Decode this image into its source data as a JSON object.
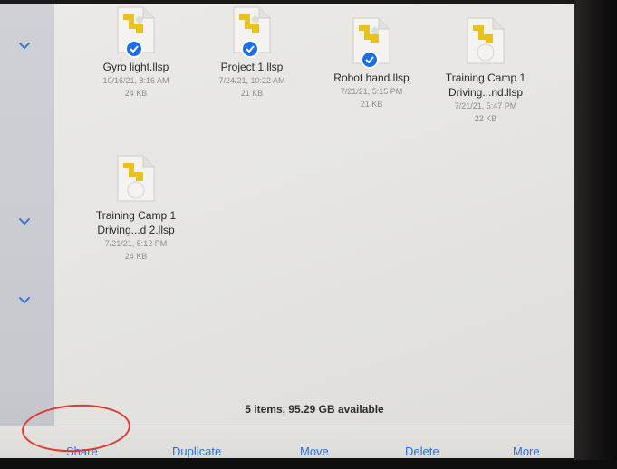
{
  "sidebar": {
    "chevrons": [
      {
        "icon": "chevron-down-icon"
      },
      {
        "icon": "chevron-down-icon"
      },
      {
        "icon": "chevron-down-icon"
      }
    ]
  },
  "files": [
    {
      "name": "Gyro light.llsp",
      "date": "10/16/21, 8:16 AM",
      "size": "24 KB",
      "selected": true
    },
    {
      "name": "Project 1.llsp",
      "date": "7/24/21, 10:22 AM",
      "size": "21 KB",
      "selected": true
    },
    {
      "name": "Robot hand.llsp",
      "date": "7/21/21, 5:15 PM",
      "size": "21 KB",
      "selected": true
    },
    {
      "name_line1": "Training Camp 1",
      "name_line2": "Driving...nd.llsp",
      "date": "7/21/21, 5:47 PM",
      "size": "22 KB",
      "selected": false
    },
    {
      "name_line1": "Training Camp 1",
      "name_line2": "Driving...d 2.llsp",
      "date": "7/21/21, 5:12 PM",
      "size": "24 KB",
      "selected": false
    }
  ],
  "status": "5 items, 95.29 GB available",
  "toolbar": {
    "share": "Share",
    "duplicate": "Duplicate",
    "move": "Move",
    "delete": "Delete",
    "more": "More"
  },
  "colors": {
    "accent": "#2f6fd6",
    "check": "#1f6ee8",
    "highlight_circle": "#e23a2e",
    "file_icon_yellow": "#e9c21c"
  }
}
